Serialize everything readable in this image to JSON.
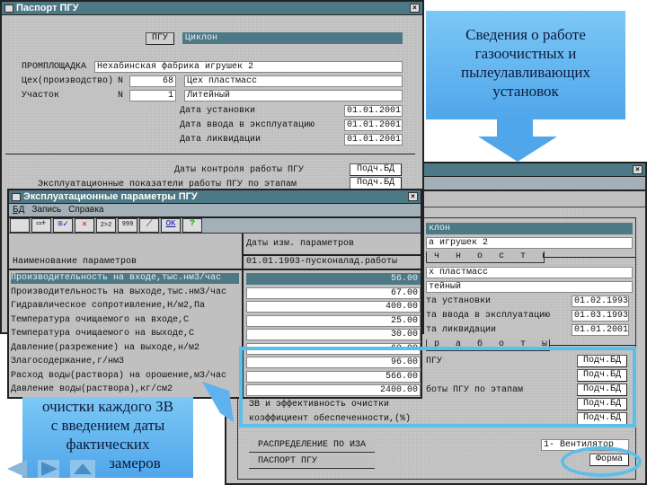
{
  "callout_top": {
    "lines": [
      "Сведения о работе",
      "газоочистных и",
      "пылеулавливающих",
      "установок"
    ]
  },
  "callout_bottom": {
    "lines": [
      "очистки каждого ЗВ",
      "с введением даты",
      "фактических",
      "замеров"
    ]
  },
  "passport": {
    "title": "Паспорт ПГУ",
    "pgu_button": "ПГУ",
    "pgu_value": "Циклон",
    "site_label": "ПРОМПЛОЩАДКА",
    "site_value": "Нехабинская фабрика игрушек 2",
    "shop_label": "Цех(производство)",
    "n_label": "N",
    "shop_number": "68",
    "shop_name": "Цех пластмасс",
    "area_label": "Участок",
    "area_number": "1",
    "area_name": "Литейный",
    "date_install_label": "Дата установки",
    "date_install": "01.01.2001",
    "date_commission_label": "Дата ввода в эксплуатацию",
    "date_commission": "01.01.2001",
    "date_liquidation_label": "Дата ликвидации",
    "date_liquidation": "01.01.2001",
    "control_dates_label": "Даты контроля работы ПГУ",
    "control_dates_btn": "Подч.БД",
    "indicators_label": "Эксплуатационные показатели работы ПГУ по этапам",
    "indicators_btn": "Подч.БД"
  },
  "passport2": {
    "pgu_value": "клон",
    "site_value": "а игрушек 2",
    "tab1": "ч н о с т ь  п г у",
    "shop_name": "х пластмасс",
    "area_name": "тейный",
    "date_install_label": "та установки",
    "date_install": "01.02.1993",
    "date_commission_label": "та ввода в эксплуатацию",
    "date_commission": "01.03.1993",
    "date_liquidation_label": "та ликвидации",
    "date_liquidation": "01.01.2001",
    "tab2": "р а б о т ы  п г у",
    "rows": [
      {
        "label": "ПГУ",
        "btn": "Подч.БД"
      },
      {
        "label": "",
        "btn": "Подч.БД"
      },
      {
        "label": "боты ПГУ по этапам",
        "btn": "Подч.БД"
      },
      {
        "label": "ЗВ и эффективность очистки",
        "btn": "Подч.БД"
      },
      {
        "label": "коэффициент обеспеченности,(%)",
        "btn": "Подч.БД"
      }
    ],
    "distribution_btn": "РАСПРЕДЕЛЕНИЕ ПО ИЗА",
    "passport_btn": "ПАСПОРТ ПГУ",
    "fan_value": "1-   Вентилятор",
    "form_btn": "Форма"
  },
  "params": {
    "title": "Эксплуатационные параметры ПГУ",
    "menu": [
      "БД",
      "Запись",
      "Справка"
    ],
    "col_name": "Наименование параметров",
    "col_dates": "Даты изм. параметров",
    "date_value": "01.01.1993-пусконалад.работы",
    "rows": [
      {
        "name": "Производительность на входе,тыс.нм3/час",
        "value": "56.00"
      },
      {
        "name": "Производительность на выходе,тыс.нм3/час",
        "value": "67.00"
      },
      {
        "name": "Гидравлическое сопротивление,Н/м2,Па",
        "value": "400.00"
      },
      {
        "name": "Температура очищаемого на входе,С",
        "value": "25.00"
      },
      {
        "name": "Температура очищаемого на выходе,С",
        "value": "30.00"
      },
      {
        "name": "Давление(разрежение) на выходе,н/м2",
        "value": "60.00"
      },
      {
        "name": "Злагосодержание,г/нм3",
        "value": "96.00"
      },
      {
        "name": "Расход воды(раствора) на орошение,м3/час",
        "value": "566.00"
      },
      {
        "name": "Давление воды(раствора),кг/см2",
        "value": "2400.00"
      }
    ],
    "toolbar": [
      "blank",
      "insert-record-icon",
      "confirm-icon",
      "delete-icon",
      "2x2-icon",
      "999-icon",
      "eraser-icon",
      "OK",
      "help-icon"
    ],
    "ok_label": "OK",
    "help_label": "?",
    "t22": "2>2",
    "t999": "999"
  },
  "colors": {
    "accent": "#4d7886",
    "highlight": "#5bbfe9",
    "callout": "#5fb2ef"
  }
}
